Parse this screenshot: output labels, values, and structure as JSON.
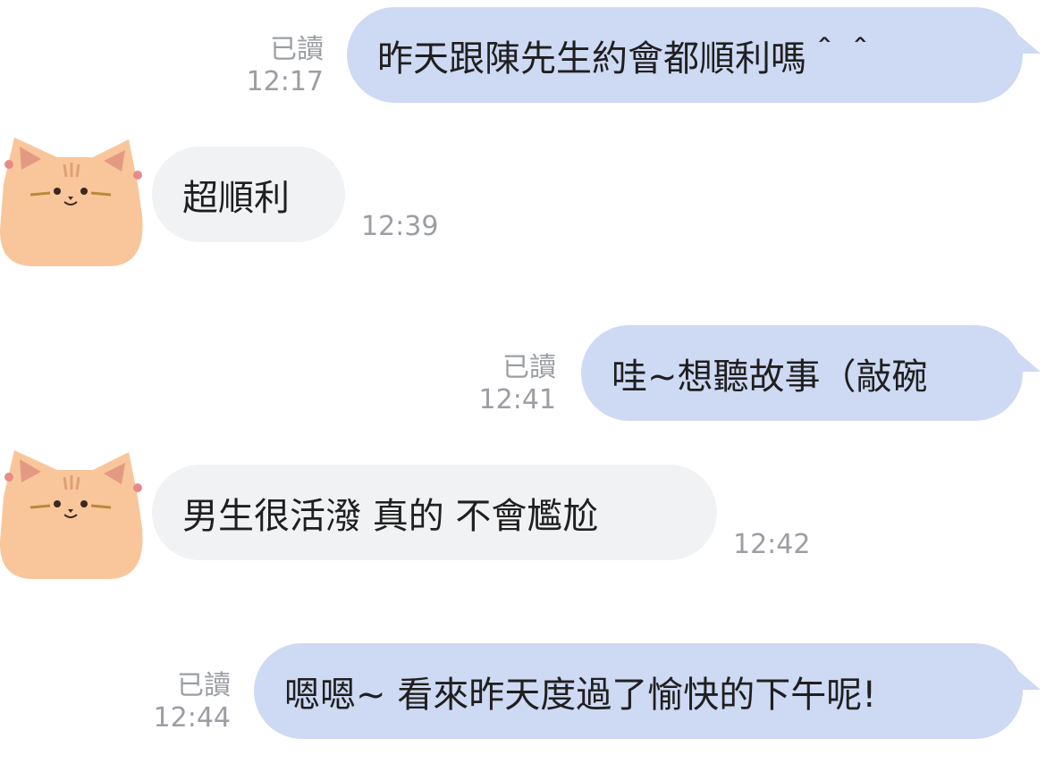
{
  "messages": [
    {
      "side": "out",
      "text": "昨天跟陳先生約會都順利嗎＾＾",
      "read": "已讀",
      "time": "12:17"
    },
    {
      "side": "in",
      "text": "超順利",
      "time": "12:39"
    },
    {
      "side": "out",
      "text": "哇~想聽故事（敲碗",
      "read": "已讀",
      "time": "12:41"
    },
    {
      "side": "in",
      "text": "男生很活潑 真的 不會尷尬",
      "time": "12:42"
    },
    {
      "side": "out",
      "text": "嗯嗯~ 看來昨天度過了愉快的下午呢!",
      "read": "已讀",
      "time": "12:44"
    }
  ],
  "avatar": {
    "icon": "cat-avatar-icon"
  },
  "colors": {
    "outgoing_bubble": "#ced9f3",
    "incoming_bubble": "#f1f2f4",
    "meta_text": "#9b9ea3",
    "cat_fill": "#f9c69b"
  }
}
